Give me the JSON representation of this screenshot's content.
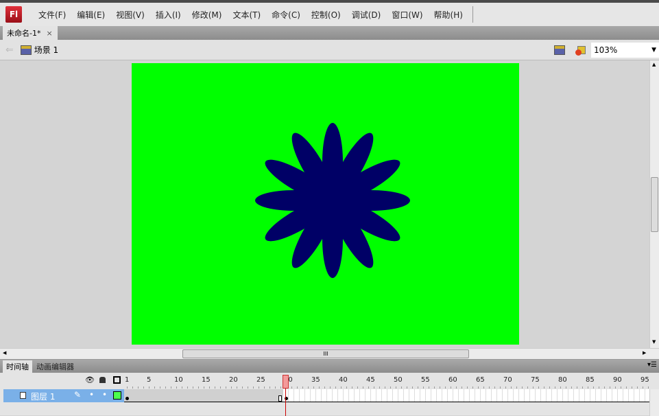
{
  "app": {
    "logo": "Fl"
  },
  "menu": [
    "文件(F)",
    "编辑(E)",
    "视图(V)",
    "插入(I)",
    "修改(M)",
    "文本(T)",
    "命令(C)",
    "控制(O)",
    "调试(D)",
    "窗口(W)",
    "帮助(H)"
  ],
  "document_tab": {
    "title": "未命名-1*",
    "close": "×"
  },
  "scene": {
    "label": "场景 1",
    "zoom": "103%"
  },
  "stage": {
    "background": "#00ff00",
    "shape_color": "#000066",
    "petals": 12
  },
  "timeline": {
    "tabs": [
      "时间轴",
      "动画编辑器"
    ],
    "ruler_labels": [
      "1",
      "5",
      "10",
      "15",
      "20",
      "25",
      "30",
      "35",
      "40",
      "45",
      "50",
      "55",
      "60",
      "65",
      "70",
      "75",
      "80",
      "85",
      "90",
      "95"
    ],
    "current_frame": 30,
    "layers": [
      {
        "name": "图层 1",
        "color": "#4cff4c",
        "keyframes": [
          1,
          30
        ]
      }
    ]
  },
  "hscroll_grip": "III"
}
